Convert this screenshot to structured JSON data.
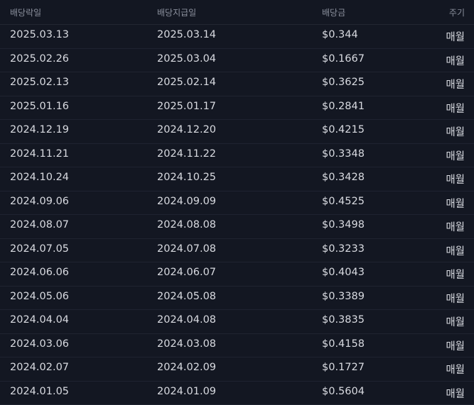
{
  "columns": {
    "ex_date": "배당락일",
    "pay_date": "배당지급일",
    "amount": "배당금",
    "frequency": "주기"
  },
  "rows": [
    {
      "ex_date": "2025.03.13",
      "pay_date": "2025.03.14",
      "amount": "$0.344",
      "frequency": "매월"
    },
    {
      "ex_date": "2025.02.26",
      "pay_date": "2025.03.04",
      "amount": "$0.1667",
      "frequency": "매월"
    },
    {
      "ex_date": "2025.02.13",
      "pay_date": "2025.02.14",
      "amount": "$0.3625",
      "frequency": "매월"
    },
    {
      "ex_date": "2025.01.16",
      "pay_date": "2025.01.17",
      "amount": "$0.2841",
      "frequency": "매월"
    },
    {
      "ex_date": "2024.12.19",
      "pay_date": "2024.12.20",
      "amount": "$0.4215",
      "frequency": "매월"
    },
    {
      "ex_date": "2024.11.21",
      "pay_date": "2024.11.22",
      "amount": "$0.3348",
      "frequency": "매월"
    },
    {
      "ex_date": "2024.10.24",
      "pay_date": "2024.10.25",
      "amount": "$0.3428",
      "frequency": "매월"
    },
    {
      "ex_date": "2024.09.06",
      "pay_date": "2024.09.09",
      "amount": "$0.4525",
      "frequency": "매월"
    },
    {
      "ex_date": "2024.08.07",
      "pay_date": "2024.08.08",
      "amount": "$0.3498",
      "frequency": "매월"
    },
    {
      "ex_date": "2024.07.05",
      "pay_date": "2024.07.08",
      "amount": "$0.3233",
      "frequency": "매월"
    },
    {
      "ex_date": "2024.06.06",
      "pay_date": "2024.06.07",
      "amount": "$0.4043",
      "frequency": "매월"
    },
    {
      "ex_date": "2024.05.06",
      "pay_date": "2024.05.08",
      "amount": "$0.3389",
      "frequency": "매월"
    },
    {
      "ex_date": "2024.04.04",
      "pay_date": "2024.04.08",
      "amount": "$0.3835",
      "frequency": "매월"
    },
    {
      "ex_date": "2024.03.06",
      "pay_date": "2024.03.08",
      "amount": "$0.4158",
      "frequency": "매월"
    },
    {
      "ex_date": "2024.02.07",
      "pay_date": "2024.02.09",
      "amount": "$0.1727",
      "frequency": "매월"
    },
    {
      "ex_date": "2024.01.05",
      "pay_date": "2024.01.09",
      "amount": "$0.5604",
      "frequency": "매월"
    }
  ]
}
